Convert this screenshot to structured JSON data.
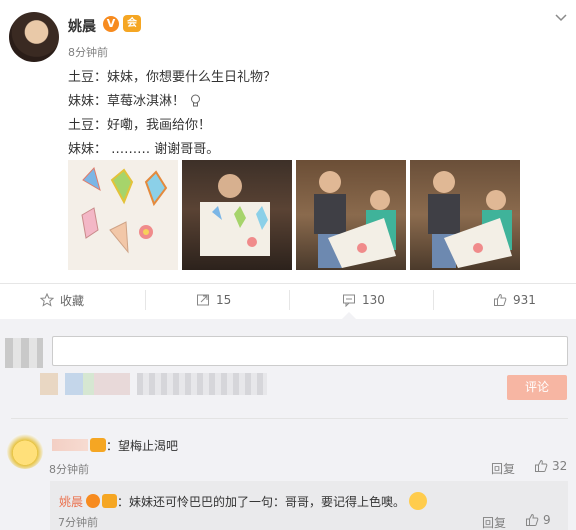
{
  "post": {
    "author": "姚晨",
    "verified_badge": "V",
    "member_badge": "会",
    "time": "8分钟前",
    "lines": [
      "土豆：妹妹，你想要什么生日礼物？",
      "妹妹：草莓冰淇淋！",
      "土豆：好嘞，我画给你！",
      "妹妹： ………    谢谢哥哥。"
    ]
  },
  "actions": {
    "favorite_label": "收藏",
    "repost_count": "15",
    "comment_count": "130",
    "like_count": "931"
  },
  "composer": {
    "input_value": "",
    "submit_label": "评论"
  },
  "comments": [
    {
      "text": "：望梅止渴吧",
      "time": "8分钟前",
      "reply_label": "回复",
      "likes": "32",
      "reply": {
        "author": "姚晨",
        "text": "：妹妹还可怜巴巴的加了一句：哥哥，要记得上色噢。",
        "time": "7分钟前",
        "reply_label": "回复",
        "likes": "9"
      }
    }
  ],
  "colors": {
    "accent": "#eb7350",
    "submit_bg": "#f7b6a3",
    "verified": "#f78b1f"
  }
}
